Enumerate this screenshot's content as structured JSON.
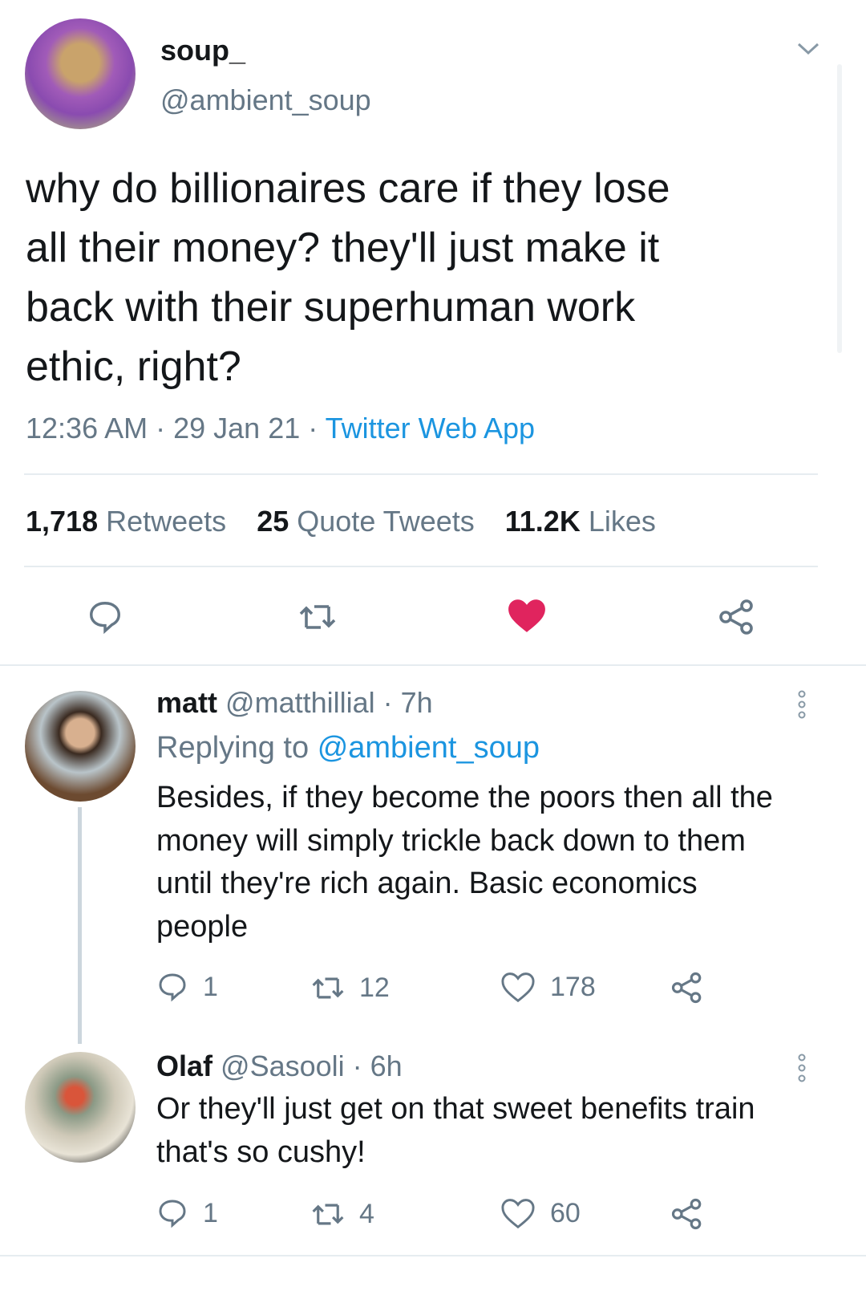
{
  "tweet": {
    "display_name": "soup_",
    "handle": "@ambient_soup",
    "text_lines": [
      "why do billionaires care if they lose",
      "all their money? they'll just make it",
      "back with their superhuman work",
      "ethic, right?"
    ],
    "time": "12:36 AM",
    "date": "29 Jan 21",
    "source": "Twitter Web App",
    "retweets": "1,718",
    "retweets_label": "Retweets",
    "quotes": "25",
    "quotes_label": "Quote Tweets",
    "likes": "11.2K",
    "likes_label": "Likes",
    "liked": true
  },
  "colors": {
    "accent": "#1b95e0",
    "like": "#e0245e",
    "text": "#14171a",
    "secondary": "#657786"
  },
  "replies": [
    {
      "name": "matt",
      "handle": "@matthillial",
      "age": "7h",
      "replying_label": "Replying to",
      "replying_to": "@ambient_soup",
      "text_lines": [
        "Besides, if they become the poors then all the",
        "money will simply trickle back down to them",
        "until they're rich again. Basic economics",
        "people"
      ],
      "replies": "1",
      "retweets": "12",
      "likes": "178"
    },
    {
      "name": "Olaf",
      "handle": "@Sasooli",
      "age": "6h",
      "text_lines": [
        "Or they'll just get on that sweet benefits train",
        "that's so cushy!"
      ],
      "replies": "1",
      "retweets": "4",
      "likes": "60"
    }
  ]
}
